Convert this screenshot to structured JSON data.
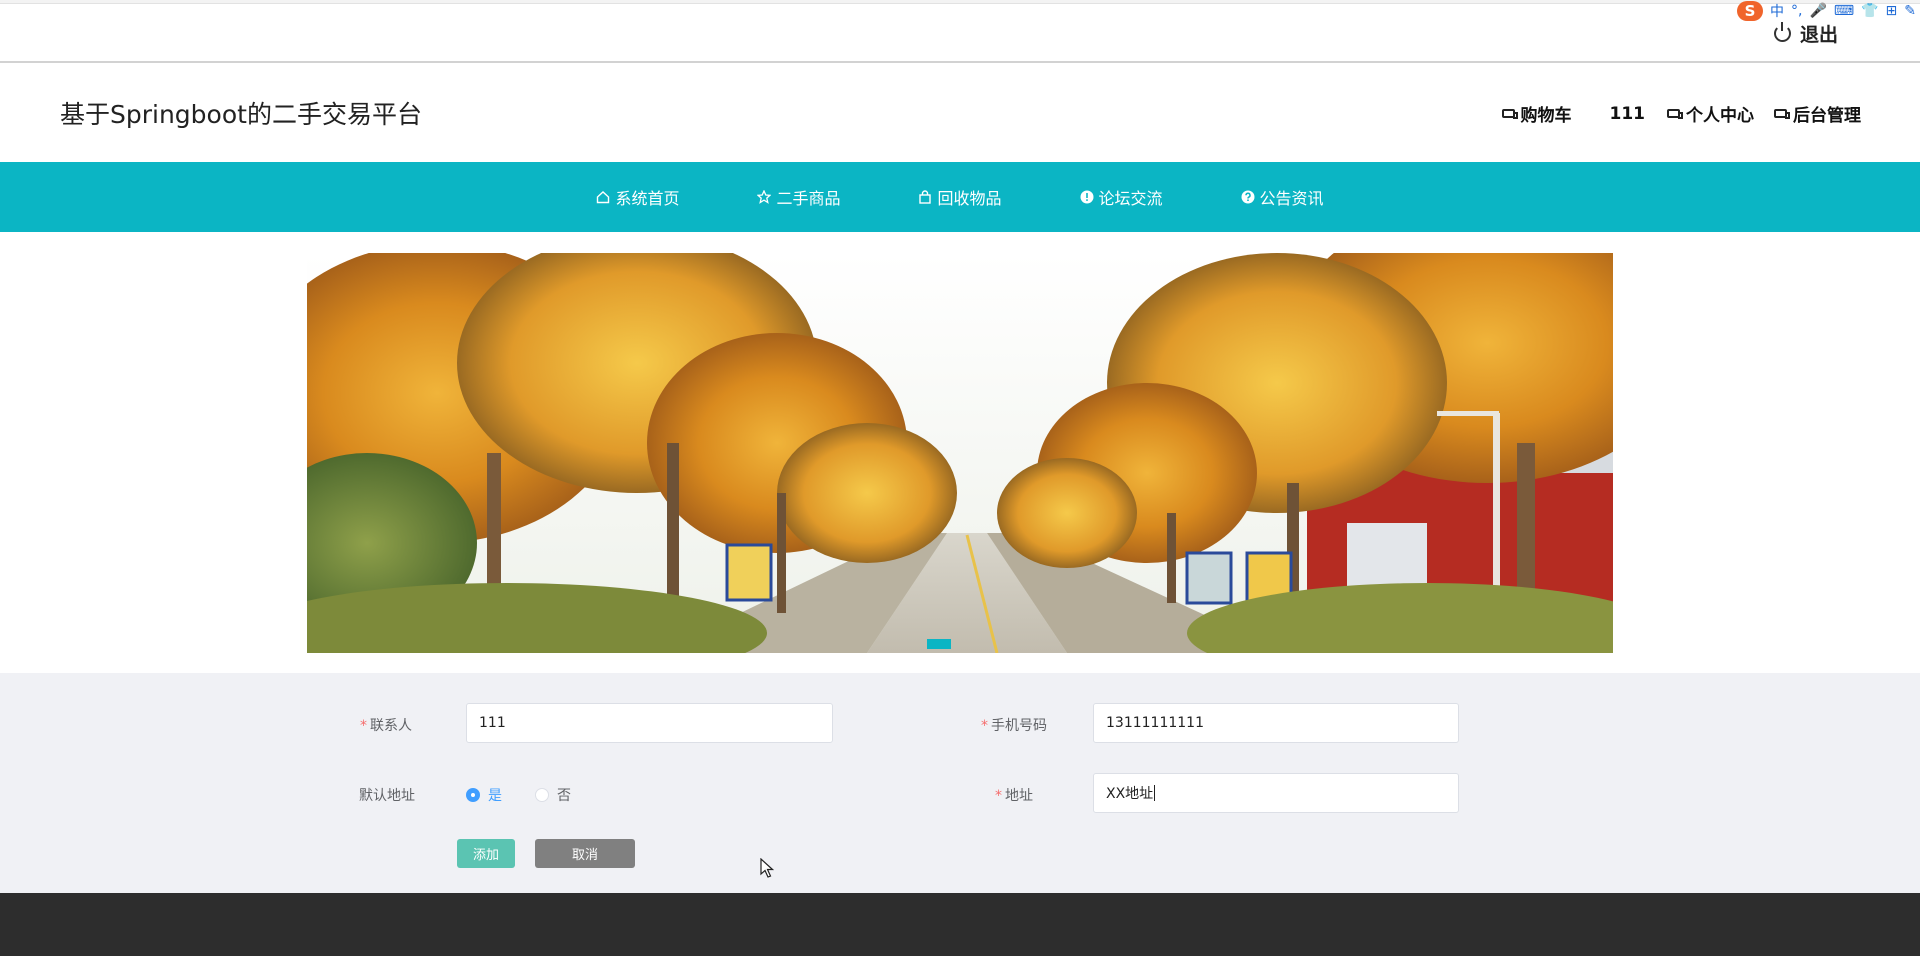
{
  "ime": {
    "items": [
      "中",
      "°,",
      "🎤",
      "⌨",
      "👕",
      "⊞",
      "✎"
    ]
  },
  "logout_label": "退出",
  "site_title": "基于Springboot的二手交易平台",
  "header_links": {
    "cart": "购物车",
    "username": "111",
    "profile": "个人中心",
    "admin": "后台管理"
  },
  "nav": [
    {
      "label": "系统首页",
      "icon": "home-icon"
    },
    {
      "label": "二手商品",
      "icon": "star-icon"
    },
    {
      "label": "回收物品",
      "icon": "bag-icon"
    },
    {
      "label": "论坛交流",
      "icon": "exclamation-circle-icon"
    },
    {
      "label": "公告资讯",
      "icon": "question-circle-icon"
    }
  ],
  "banner": {
    "slides": 1,
    "active_slide": 1
  },
  "form": {
    "contact": {
      "label": "联系人",
      "value": "111",
      "required": true
    },
    "phone": {
      "label": "手机号码",
      "value": "13111111111",
      "required": true
    },
    "default_address": {
      "label": "默认地址",
      "options": [
        "是",
        "否"
      ],
      "selected": "是"
    },
    "address": {
      "label": "地址",
      "value": "XX地址",
      "required": true
    },
    "add_button": "添加",
    "cancel_button": "取消"
  },
  "colors": {
    "nav_bg": "#0bb5c4",
    "add_btn": "#5bc4b2",
    "cancel_btn": "#808080",
    "footer_bg": "#2d2d2d"
  }
}
